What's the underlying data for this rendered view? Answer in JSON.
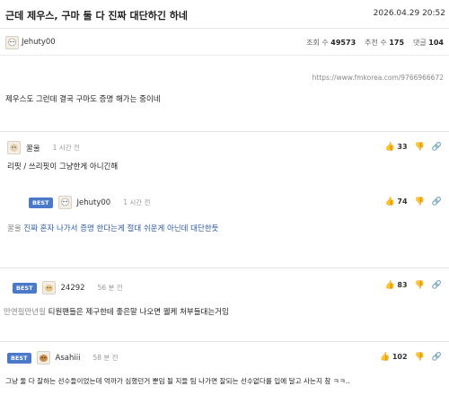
{
  "post": {
    "title": "근데 제우스, 구마 둘 다 진짜 대단하긴 하네",
    "date": "2026.04.29 20:52",
    "author": "Jehuty00",
    "stats": {
      "views_label": "조회 수",
      "views": "49573",
      "likes_label": "추천 수",
      "likes": "175",
      "comments_label": "댓글",
      "comments": "104"
    },
    "url": "https://www.fmkorea.com/9766966672",
    "body": "제우스도 그런데 결국 구마도 증명 해가는 중이네"
  },
  "comments": [
    {
      "author": "꿀울",
      "time": "1 시간 전",
      "text": "리핏 / 쓰리핏이 그냥한게 아니긴해",
      "likes": "33"
    },
    {
      "best": "BEST",
      "author": "Jehuty00",
      "time": "1 시간 전",
      "reply_to": "꿀울",
      "text": "진짜 혼자 나가서 증명 한다는게 절대 쉬운게 아닌데 대단한듯",
      "likes": "74"
    },
    {
      "best": "BEST",
      "author": "24292",
      "time": "56 분 전",
      "reply_to": "만연필만년필",
      "text": "티원팬들은 제구한테 좋은말 나오면 웰케 처부들대는거임",
      "likes": "83"
    },
    {
      "best": "BEST",
      "author": "Asahiii",
      "time": "58 분 전",
      "text": "그냥 둘 다 잘하는 선수들이었는데 억까가 심했던거 뿐임 될 지들 팀 나가면 잘되는 선수없다를 입에 달고 사는지 참 ㅋㅋ..",
      "likes": "102"
    }
  ],
  "icons": {
    "like": "thumbs-up-icon",
    "dislike": "thumbs-down-icon",
    "link": "link-icon"
  },
  "colors": {
    "best_badge": "#4a79c9",
    "link_text": "#2c5aa0"
  }
}
